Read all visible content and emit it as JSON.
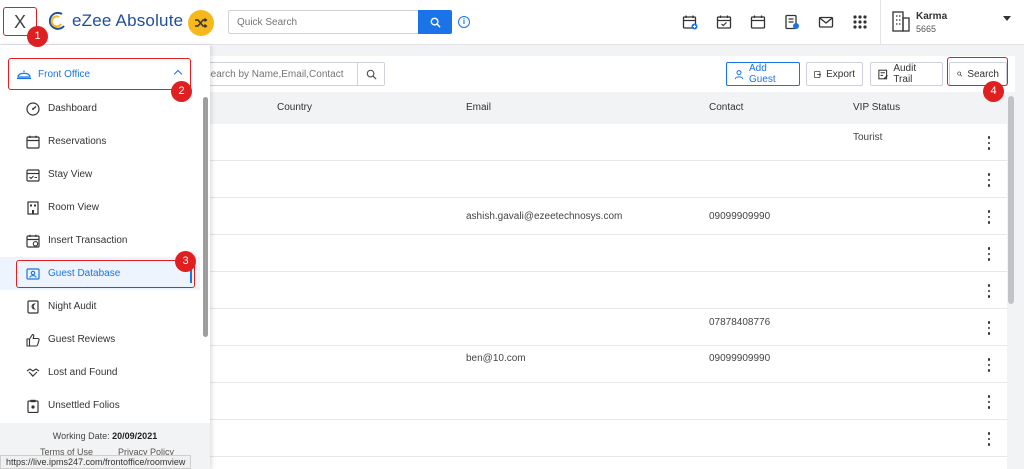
{
  "topbar": {
    "close_label": "X",
    "brand_name": "eZee Absolute",
    "quick_search_placeholder": "Quick Search",
    "info_label": "i",
    "icons": [
      "calendar-plus-icon",
      "calendar-check-icon",
      "calendar-icon",
      "receipt-icon",
      "mail-icon",
      "apps-grid-icon"
    ],
    "hotel_name": "Karma",
    "hotel_code": "5665"
  },
  "sidebar": {
    "section_label": "Front Office",
    "items": [
      {
        "label": "Dashboard",
        "icon": "gauge-icon",
        "active": false
      },
      {
        "label": "Reservations",
        "icon": "calendar-icon",
        "active": false
      },
      {
        "label": "Stay View",
        "icon": "stay-view-icon",
        "active": false
      },
      {
        "label": "Room View",
        "icon": "room-view-icon",
        "active": false
      },
      {
        "label": "Insert Transaction",
        "icon": "insert-transaction-icon",
        "active": false
      },
      {
        "label": "Guest Database",
        "icon": "guest-card-icon",
        "active": true
      },
      {
        "label": "Night Audit",
        "icon": "night-audit-icon",
        "active": false
      },
      {
        "label": "Guest Reviews",
        "icon": "thumbs-up-icon",
        "active": false
      },
      {
        "label": "Lost and Found",
        "icon": "handshake-icon",
        "active": false
      },
      {
        "label": "Unsettled Folios",
        "icon": "clipboard-icon",
        "active": false
      }
    ],
    "working_date_label": "Working Date:",
    "working_date_value": "20/09/2021",
    "terms_label": "Terms of Use",
    "privacy_label": "Privacy Policy"
  },
  "toolbar": {
    "search_placeholder": "Search by Name,Email,Contact",
    "add_guest_label": "Add Guest",
    "export_label": "Export",
    "audit_trail_label": "Audit Trail",
    "search_label": "Search"
  },
  "table": {
    "headers": {
      "country": "Country",
      "email": "Email",
      "contact": "Contact",
      "vip": "VIP Status"
    },
    "rows": [
      {
        "country": "",
        "email": "",
        "contact": "",
        "vip": "Tourist"
      },
      {
        "country": "",
        "email": "",
        "contact": "",
        "vip": ""
      },
      {
        "country": "",
        "email": "ashish.gavali@ezeetechnosys.com",
        "contact": "09099909990",
        "vip": ""
      },
      {
        "country": "",
        "email": "",
        "contact": "",
        "vip": ""
      },
      {
        "country": "",
        "email": "",
        "contact": "",
        "vip": ""
      },
      {
        "country": "",
        "email": "",
        "contact": "07878408776",
        "vip": ""
      },
      {
        "country": "",
        "email": "ben@10.com",
        "contact": "09099909990",
        "vip": ""
      },
      {
        "country": "",
        "email": "",
        "contact": "",
        "vip": ""
      },
      {
        "country": "",
        "email": "",
        "contact": "",
        "vip": ""
      }
    ]
  },
  "statusbar": {
    "url": "https://live.ipms247.com/frontoffice/roomview"
  },
  "markers": [
    "1",
    "2",
    "3",
    "4"
  ],
  "colors": {
    "accent": "#1a73e8",
    "brand": "#1f4e9c",
    "shuffle": "#f7b81e",
    "marker": "#e02020"
  }
}
